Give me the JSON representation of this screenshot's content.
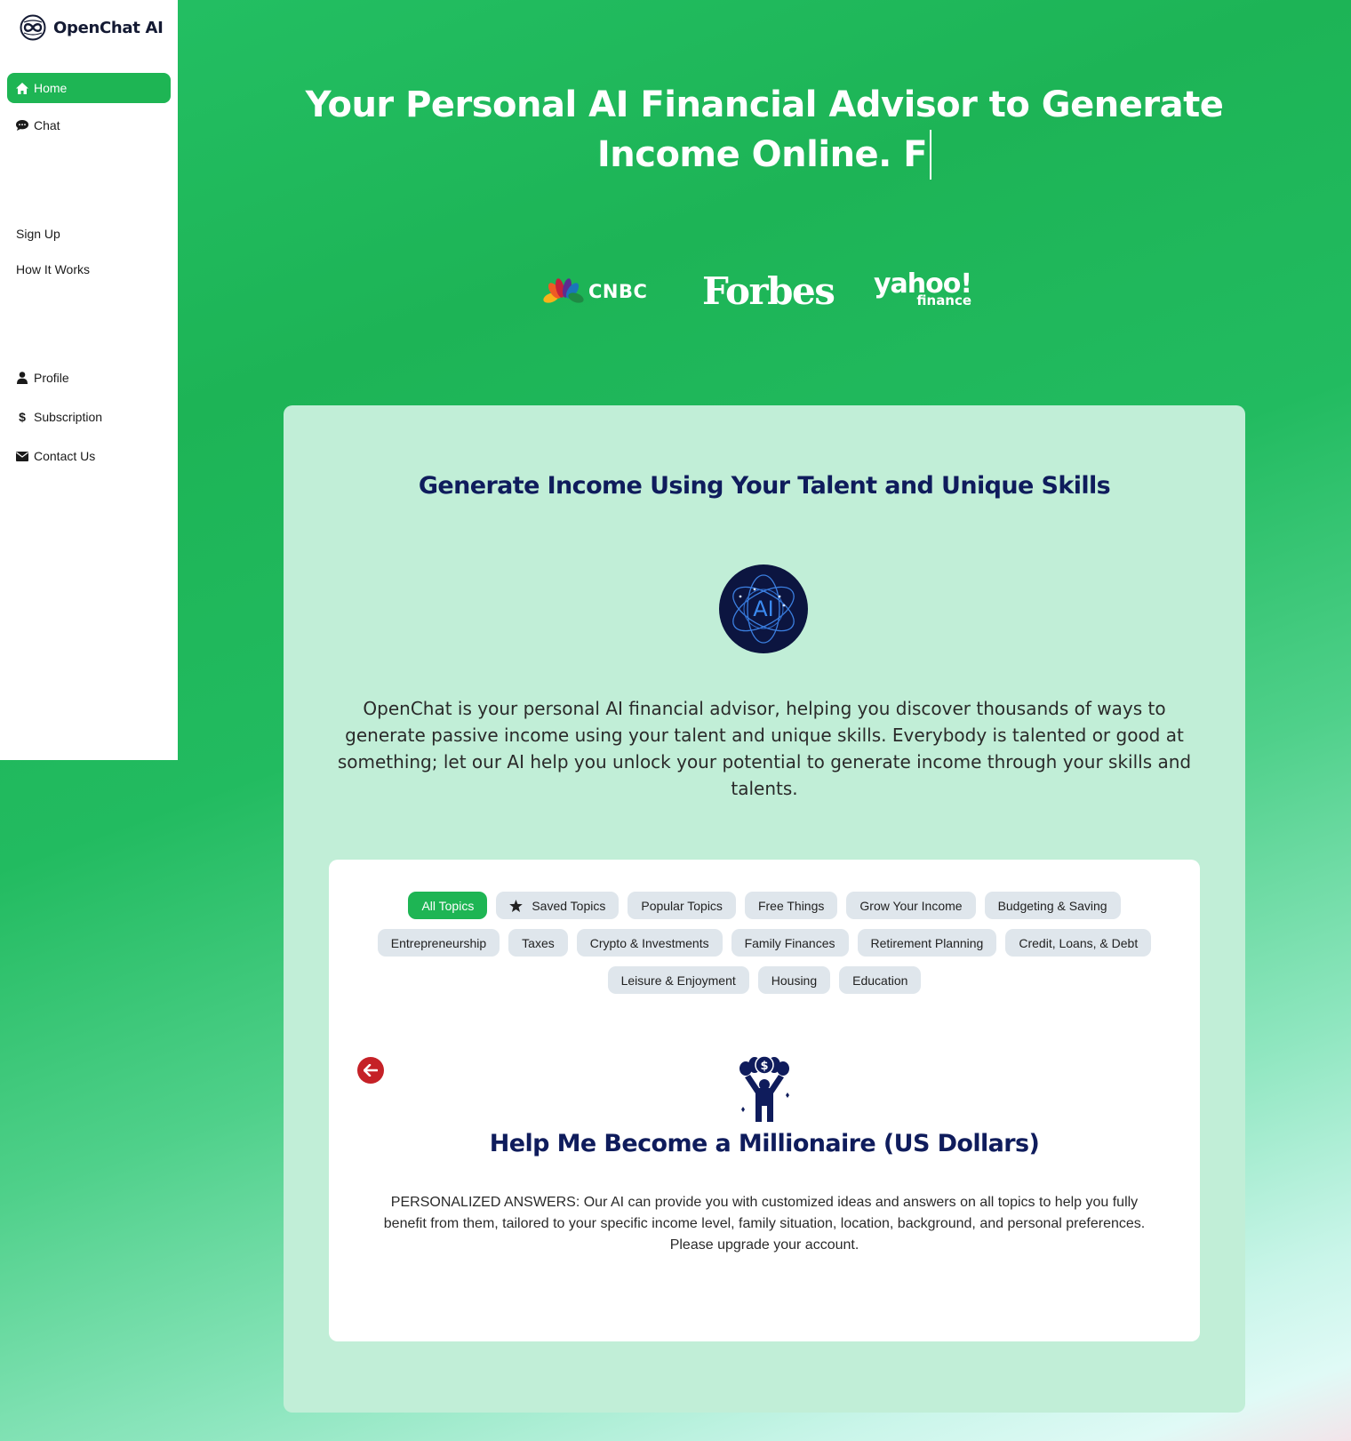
{
  "brand": {
    "name": "OpenChat AI",
    "logo_icon": "infinity-globe-icon"
  },
  "sidebar": {
    "items": [
      {
        "label": "Home",
        "icon": "home-icon",
        "active": true
      },
      {
        "label": "Chat",
        "icon": "chat-bubble-icon",
        "active": false
      },
      {
        "label": "Sign Up",
        "icon": null,
        "active": false
      },
      {
        "label": "How It Works",
        "icon": null,
        "active": false
      },
      {
        "label": "Profile",
        "icon": "user-icon",
        "active": false
      },
      {
        "label": "Subscription",
        "icon": "dollar-icon",
        "active": false
      },
      {
        "label": "Contact Us",
        "icon": "envelope-icon",
        "active": false
      }
    ]
  },
  "hero": {
    "title_line1": "Your Personal AI Financial Advisor to Generate",
    "title_line2": "Income Online. F",
    "press_logos": [
      {
        "name": "CNBC",
        "text": "CNBC"
      },
      {
        "name": "Forbes",
        "text": "Forbes"
      },
      {
        "name": "Yahoo Finance",
        "text_top": "yahoo!",
        "text_bottom": "finance"
      }
    ]
  },
  "card": {
    "title": "Generate Income Using Your Talent and Unique Skills",
    "ai_badge_text": "AI",
    "description": "OpenChat is your personal AI financial advisor, helping you discover thousands of ways to generate passive income using your talent and unique skills. Everybody is talented or good at something; let our AI help you unlock your potential to generate income through your skills and talents."
  },
  "topics": {
    "chips": [
      {
        "label": "All Topics",
        "active": true
      },
      {
        "label": "Saved Topics",
        "icon": "star-icon"
      },
      {
        "label": "Popular Topics"
      },
      {
        "label": "Free Things"
      },
      {
        "label": "Grow Your Income"
      },
      {
        "label": "Budgeting & Saving"
      },
      {
        "label": "Entrepreneurship"
      },
      {
        "label": "Taxes"
      },
      {
        "label": "Crypto & Investments"
      },
      {
        "label": "Family Finances"
      },
      {
        "label": "Retirement Planning"
      },
      {
        "label": "Credit, Loans, & Debt"
      },
      {
        "label": "Leisure & Enjoyment"
      },
      {
        "label": "Housing"
      },
      {
        "label": "Education"
      }
    ],
    "selected_topic": {
      "title": "Help Me Become a Millionaire (US Dollars)",
      "icon": "person-with-money-icon",
      "description": "PERSONALIZED ANSWERS: Our AI can provide you with customized ideas and answers on all topics to help you fully benefit from them, tailored to your specific income level, family situation, location, background, and personal preferences. Please upgrade your account."
    },
    "back_button_icon": "arrow-left-icon"
  },
  "colors": {
    "accent_green": "#1eb554",
    "navy": "#0f1c5c",
    "card_bg": "#c1eed7",
    "chip_bg": "#dfe6ec",
    "back_button": "#c52127"
  }
}
